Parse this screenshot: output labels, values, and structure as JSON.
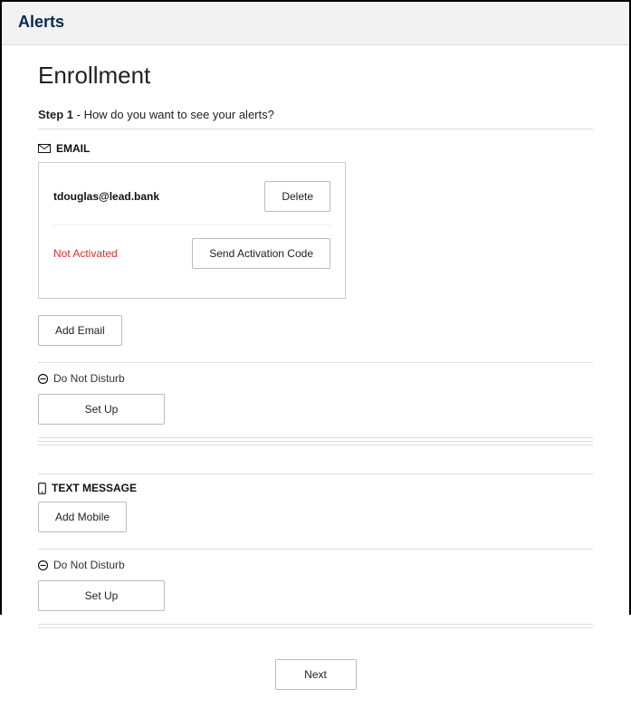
{
  "header": {
    "title": "Alerts"
  },
  "page": {
    "title": "Enrollment"
  },
  "step": {
    "label": "Step 1",
    "question": " - How do you want to see your alerts?"
  },
  "email_section": {
    "heading": "EMAIL",
    "card": {
      "address": "tdouglas@lead.bank",
      "delete_label": "Delete",
      "status": "Not Activated",
      "send_code_label": "Send Activation Code"
    },
    "add_label": "Add Email",
    "dnd": {
      "label": "Do Not Disturb",
      "setup_label": "Set Up"
    }
  },
  "sms_section": {
    "heading": "TEXT MESSAGE",
    "add_label": "Add Mobile",
    "dnd": {
      "label": "Do Not Disturb",
      "setup_label": "Set Up"
    }
  },
  "footer": {
    "next_label": "Next"
  }
}
